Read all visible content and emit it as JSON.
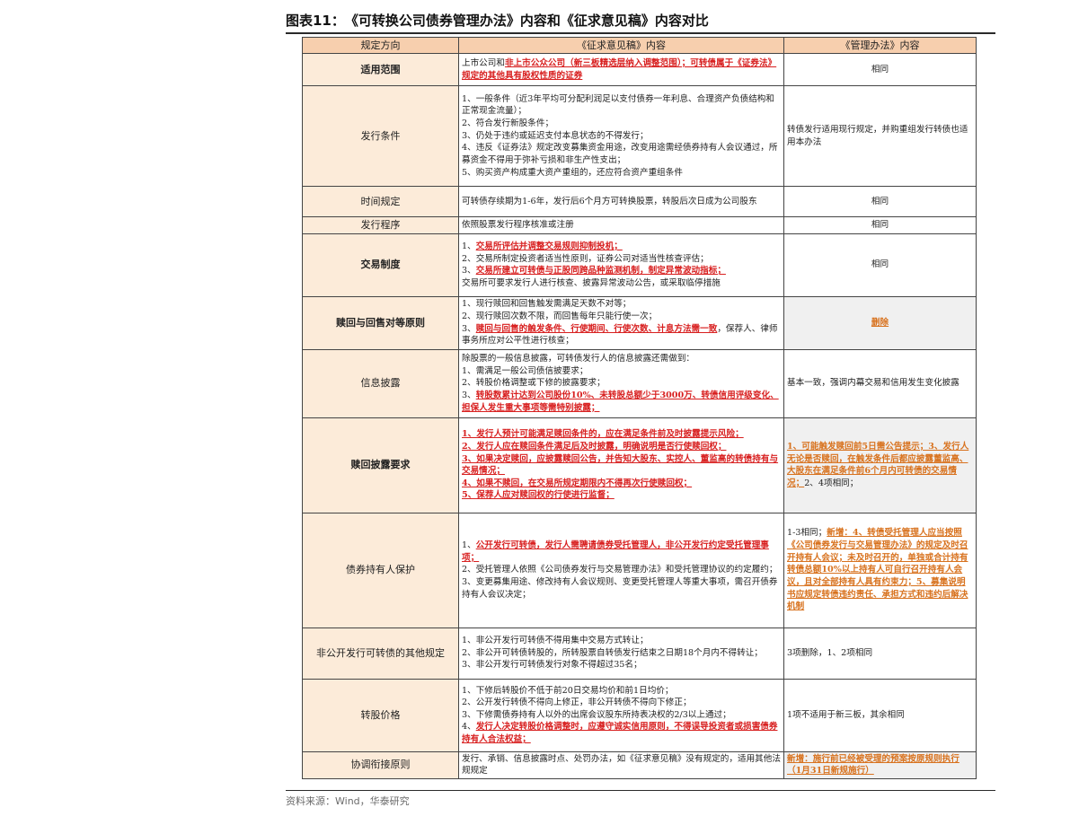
{
  "title": "图表11：　《可转换公司债券管理办法》内容和《征求意见稿》内容对比",
  "headers": [
    "规定方向",
    "《征求意见稿》内容",
    "《管理办法》内容"
  ],
  "rows": [
    {
      "key": "适用范围",
      "content": [
        "上市公司和",
        "非上市公众公司（新三板精选层纳入调整范围）；可转债属于《证券法》规定的其他具有股权性质的证券"
      ],
      "mgmt": "相同"
    },
    {
      "key": "发行条件",
      "content": [
        "1、一般条件（近3年平均可分配利润足以支付债券一年利息、合理资产负债结构和正常现金流量）；",
        "2、符合发行新股条件；",
        "3、仍处于违约或延迟支付本息状态的不得发行；",
        "4、违反《证券法》规定改变募集资金用途，改变用途需经债券持有人会议通过，所募资金不得用于弥补亏损和非生产性支出；",
        "5、购买资产构成重大资产重组的，还应符合资产重组条件"
      ],
      "mgmt": "转债发行适用现行规定，并购重组发行转债也适用本办法"
    },
    {
      "key": "时间规定",
      "content": [
        "可转债存续期为1-6年，发行后6个月方可转换股票，转股后次日成为公司股东"
      ],
      "mgmt": "相同"
    },
    {
      "key": "发行程序",
      "content": [
        "依照股票发行程序核准或注册"
      ],
      "mgmt": "相同"
    },
    {
      "key": "交易制度",
      "content": [
        "1、",
        "交易所评估并调整交易规则抑制投机；",
        "2、交易所制定投资者适当性原则，证券公司对适当性核查评估；",
        "3、",
        "交易所建立可转债与正股同跨品种监测机制，制定异常波动指标；",
        "交易所可要求发行人进行核查、披露异常波动公告，或采取临停措施"
      ],
      "mgmt": "相同"
    },
    {
      "key": "赎回与回售对等原则",
      "content": [
        "1、现行赎回和回售触发需满足天数不对等；",
        "2、现行赎回次数不限，而回售每年只能行使一次；",
        "3、",
        "赎回与回售的触发条件、行使期间、行使次数、计息方法需一致",
        "，保荐人、律师事务所应对公平性进行核查；"
      ],
      "mgmt": "删除"
    },
    {
      "key": "信息披露",
      "content": [
        "除股票的一般信息披露，可转债发行人的信息披露还需做到：",
        "1、需满足一般公司债信披要求；",
        "2、转股价格调整或下修的披露要求；",
        "3、",
        "转股数累计达到公司股份10%、未转股总额少于3000万、转债信用评级变化、担保人发生重大事项等需特别披露；"
      ],
      "mgmt": "基本一致，强调内幕交易和信用发生变化披露"
    },
    {
      "key": "赎回披露要求",
      "content": [
        "1、发行人预计可能满足赎回条件的，应在满足条件前及时披露提示风险；",
        "2、发行人应在赎回条件满足后及时披露，明确说明是否行使赎回权；",
        "3、如果决定赎回，应披露赎回公告，并告知大股东、实控人、董监高的转债持有与交易情况；",
        "4、如果不赎回，在交易所规定期限内不得再次行使赎回权；",
        "5、保荐人应对赎回权的行使进行监督；"
      ],
      "mgmt": [
        "1、可能触发赎回前5日需公告提示；3、发行人无论是否赎回，在触发条件后都应披露董监高、大股东在满足条件前6个月内可转债的交易情况；",
        "2、4项相同；"
      ]
    },
    {
      "key": "债券持有人保护",
      "content": [
        "1、",
        "公开发行可转债，发行人需聘请债券受托管理人，非公开发行约定受托管理事项；",
        "2、受托管理人依照《公司债券发行与交易管理办法》和受托管理协议的约定履约；",
        "3、变更募集用途、修改持有人会议规则、变更受托管理人等重大事项，需召开债券持有人会议决定；"
      ],
      "mgmt": [
        "1-3相同；",
        "新增：4、转债受托管理人应当按照《公司债券发行与交易管理办法》的规定及时召开持有人会议；未及时召开的，单独或合计持有转债总额10%以上持有人可自行召开持有人会议，且对全部持有人具有约束力；5、募集说明书应规定转债违约责任、承担方式和违约后解决机制"
      ]
    },
    {
      "key": "非公开发行可转债的其他规定",
      "content": [
        "1、非公开发行可转债不得用集中交易方式转让；",
        "2、非公开可转债转股的，所转股票自转债发行结束之日期18个月内不得转让；",
        "3、非公开发行可转债发行对象不得超过35名；"
      ],
      "mgmt": "3项删除，1、2项相同"
    },
    {
      "key": "转股价格",
      "content": [
        "1、下修后转股价不低于前20日交易均价和前1日均价；",
        "2、公开发行转债不得向上修正，非公开转债不得向下修正；",
        "3、下修需债券持有人以外的出席会议股东所持表决权的2/3以上通过；",
        "4、",
        "发行人决定转股价格调整时，应遵守诚实信用原则，不得误导投资者或损害债券持有人合法权益；"
      ],
      "mgmt": "1项不适用于新三板，其余相同"
    },
    {
      "key": "协调衔接原则",
      "content": [
        "发行、承销、信息披露时点、处罚办法，如《征求意见稿》没有规定的，适用其他法规规定"
      ],
      "mgmt": "新增：施行前已经被受理的预案按原规则执行（1月31日新规施行）"
    }
  ],
  "source": "资料来源：Wind，华泰研究",
  "colors": {
    "header_bg": "#f7cfae",
    "key_bg": "#fcebd9",
    "red": "#d82020",
    "orange": "#d8721e",
    "grey": "#f0f0f0"
  }
}
